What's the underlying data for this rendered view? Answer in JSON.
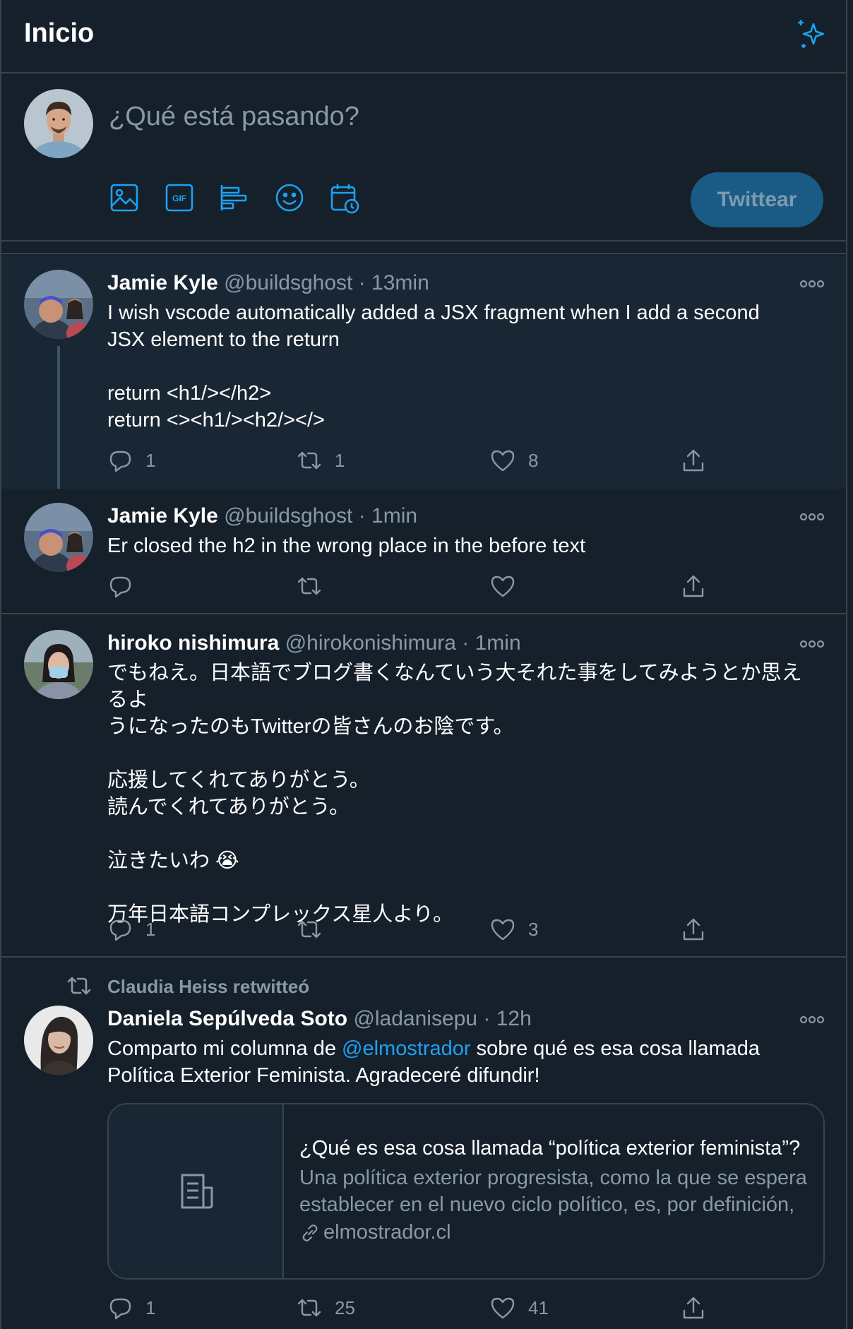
{
  "header": {
    "title": "Inicio"
  },
  "composer": {
    "placeholder": "¿Qué está pasando?",
    "submit_label": "Twittear"
  },
  "tweets": [
    {
      "name": "Jamie Kyle",
      "handle": "@buildsghost",
      "sep": "·",
      "time": "13min",
      "lines": [
        "I wish vscode automatically added a JSX fragment when I add a second",
        "JSX element to the return",
        "",
        "return <h1/></h2>",
        "return <><h1/><h2/></>"
      ],
      "replies": "1",
      "retweets": "1",
      "likes": "8"
    },
    {
      "name": "Jamie Kyle",
      "handle": "@buildsghost",
      "sep": "·",
      "time": "1min",
      "lines": [
        "Er closed the h2 in the wrong place in the before text"
      ],
      "replies": "",
      "retweets": "",
      "likes": ""
    },
    {
      "name": "hiroko nishimura",
      "handle": "@hirokonishimura",
      "sep": "·",
      "time": "1min",
      "lines": [
        "でもねえ。日本語でブログ書くなんていう大それた事をしてみようとか思えるよ",
        "うになったのもTwitterの皆さんのお陰です。",
        "",
        "応援してくれてありがとう。",
        "読んでくれてありがとう。",
        "",
        "泣きたいわ 😭",
        "",
        "万年日本語コンプレックス星人より。"
      ],
      "replies": "1",
      "retweets": "",
      "likes": "3"
    },
    {
      "retweeted_by": "Claudia Heiss retwitteó",
      "name": "Daniela Sepúlveda Soto",
      "handle": "@ladanisepu",
      "sep": "·",
      "time": "12h",
      "text_prefix": "Comparto mi columna de ",
      "mention": "@elmostrador",
      "text_suffix": " sobre qué es esa cosa llamada",
      "line2": "Política Exterior Feminista. Agradeceré difundir!",
      "card": {
        "title": "¿Qué es esa cosa llamada “política exterior feminista”?",
        "description": "Una política exterior progresista, como la que se espera establecer en el nuevo ciclo político, es, por definición, una política exterior feminista.",
        "domain": "elmostrador.cl"
      },
      "replies": "1",
      "retweets": "25",
      "likes": "41"
    }
  ],
  "colors": {
    "background": "#15202b",
    "accent": "#1da1f2",
    "muted": "#8899a6",
    "border": "#38444d"
  },
  "icons": [
    "sparkle-icon",
    "image-icon",
    "gif-icon",
    "poll-icon",
    "emoji-icon",
    "schedule-icon",
    "more-icon",
    "reply-icon",
    "retweet-icon",
    "like-icon",
    "share-icon",
    "document-icon",
    "link-icon"
  ]
}
